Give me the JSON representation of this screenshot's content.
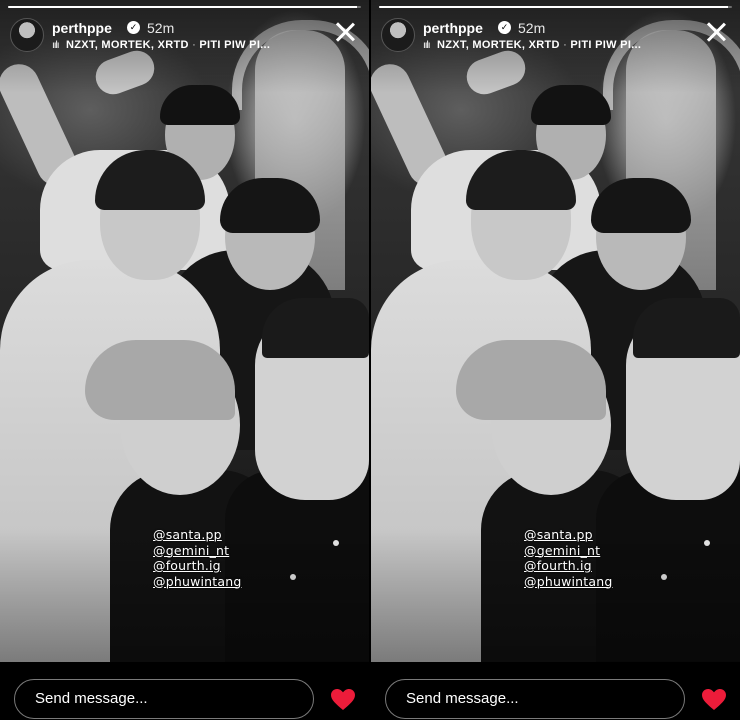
{
  "story": {
    "username": "perthppe",
    "verified_mark": "✓",
    "time_ago": "52m",
    "music_icon": "music-bars-icon",
    "music_glyph": "ıılı",
    "music_artists": "NZXT, MORTEK, XRTD",
    "music_separator": " · ",
    "music_title": "PITI PIW PI...",
    "progress": 0.99,
    "mentions": [
      "@santa.pp",
      "@gemini_nt",
      "@fourth.ig",
      "@phuwintang"
    ],
    "reply_placeholder": "Send message...",
    "heart_color": "#ed1c3a",
    "close_icon": "close-icon"
  }
}
